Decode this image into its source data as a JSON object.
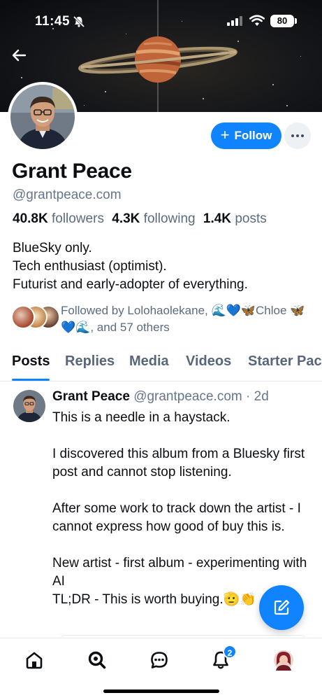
{
  "status_bar": {
    "time": "11:45",
    "battery": "80"
  },
  "profile": {
    "display_name": "Grant Peace",
    "handle": "@grantpeace.com",
    "follow_label": "Follow",
    "followers_count": "40.8K",
    "followers_label": "followers",
    "following_count": "4.3K",
    "following_label": "following",
    "posts_count": "1.4K",
    "posts_label": "posts",
    "bio": [
      "BlueSky only.",
      "Tech enthusiast (optimist).",
      "Futurist and early-adopter of everything."
    ],
    "followed_by": "Followed by Lolohaolekane, 🌊💙🦋Chloe 🦋💙🌊, and 57 others"
  },
  "tabs": [
    {
      "label": "Posts",
      "active": true
    },
    {
      "label": "Replies"
    },
    {
      "label": "Media"
    },
    {
      "label": "Videos"
    },
    {
      "label": "Starter Packs"
    }
  ],
  "post": {
    "author": "Grant Peace",
    "handle": "@grantpeace.com",
    "separator": "·",
    "time": "2d",
    "paragraphs": [
      "This is a needle in a haystack.",
      "I discovered this album from a Bluesky first post and cannot stop listening.",
      "After some work to track down the artist - I cannot express how good of buy this is.",
      "New artist - first album - experimenting with AI\nTL;DR - This is worth buying.🫡👏"
    ]
  },
  "nav": {
    "notifications_badge": "2",
    "items": [
      "home-icon",
      "search-icon",
      "chat-icon",
      "bell-icon",
      "profile-avatar"
    ]
  },
  "colors": {
    "accent": "#1083fe",
    "muted_text": "#66768a"
  }
}
